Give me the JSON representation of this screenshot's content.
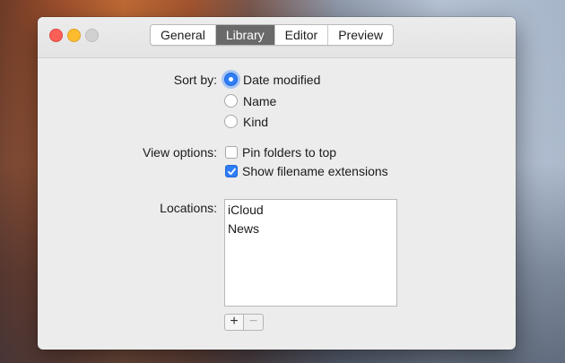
{
  "tabs": [
    {
      "label": "General",
      "active": false
    },
    {
      "label": "Library",
      "active": true
    },
    {
      "label": "Editor",
      "active": false
    },
    {
      "label": "Preview",
      "active": false
    }
  ],
  "sort": {
    "label": "Sort by:",
    "options": [
      "Date modified",
      "Name",
      "Kind"
    ],
    "selected": "Date modified"
  },
  "view_options": {
    "label": "View options:",
    "items": [
      {
        "label": "Pin folders to top",
        "checked": false
      },
      {
        "label": "Show filename extensions",
        "checked": true
      }
    ]
  },
  "locations": {
    "label": "Locations:",
    "items": [
      "iCloud",
      "News"
    ],
    "add_label": "+",
    "remove_label": "−"
  },
  "colors": {
    "accent": "#2f7ef7",
    "close": "#fc5f57",
    "minimize": "#fdbc2e"
  }
}
